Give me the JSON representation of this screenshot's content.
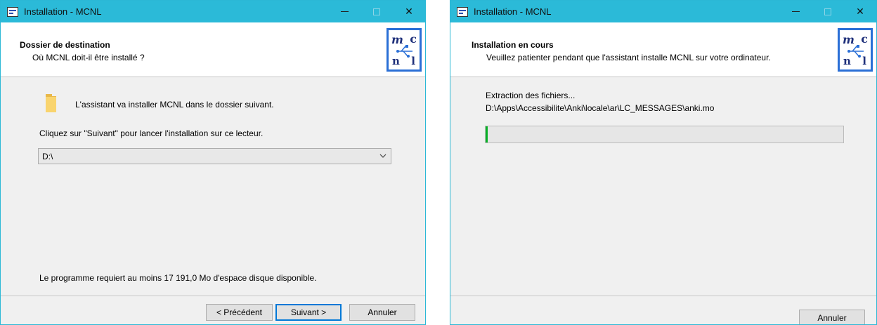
{
  "left_window": {
    "title": "Installation - MCNL",
    "header": {
      "title": "Dossier de destination",
      "subtitle": "Où MCNL doit-il être installé ?"
    },
    "body": {
      "intro": "L'assistant va installer MCNL dans le dossier suivant.",
      "instruction": "Cliquez sur \"Suivant\" pour lancer l'installation sur ce lecteur.",
      "folder_value": "D:\\",
      "space_required": "Le programme requiert au moins 17 191,0 Mo d'espace disque disponible."
    },
    "buttons": {
      "back": "< Précédent",
      "next": "Suivant >",
      "cancel": "Annuler"
    }
  },
  "right_window": {
    "title": "Installation - MCNL",
    "header": {
      "title": "Installation en cours",
      "subtitle": "Veuillez patienter pendant que l'assistant installe MCNL sur votre ordinateur."
    },
    "body": {
      "status": "Extraction des fichiers...",
      "current_file": "D:\\Apps\\Accessibilite\\Anki\\locale\\ar\\LC_MESSAGES\\anki.mo",
      "progress_fraction": 0.005
    },
    "buttons": {
      "cancel": "Annuler"
    }
  },
  "titlebar_controls": {
    "close_glyph": "✕"
  },
  "logo": {
    "letters": [
      "m",
      "c",
      "n",
      "l"
    ],
    "color": "#1e2f7a",
    "border_color": "#2a6fd6"
  },
  "colors": {
    "titlebar": "#2bbad8",
    "progress_fill": "#06b025",
    "default_button_border": "#0078d7"
  }
}
